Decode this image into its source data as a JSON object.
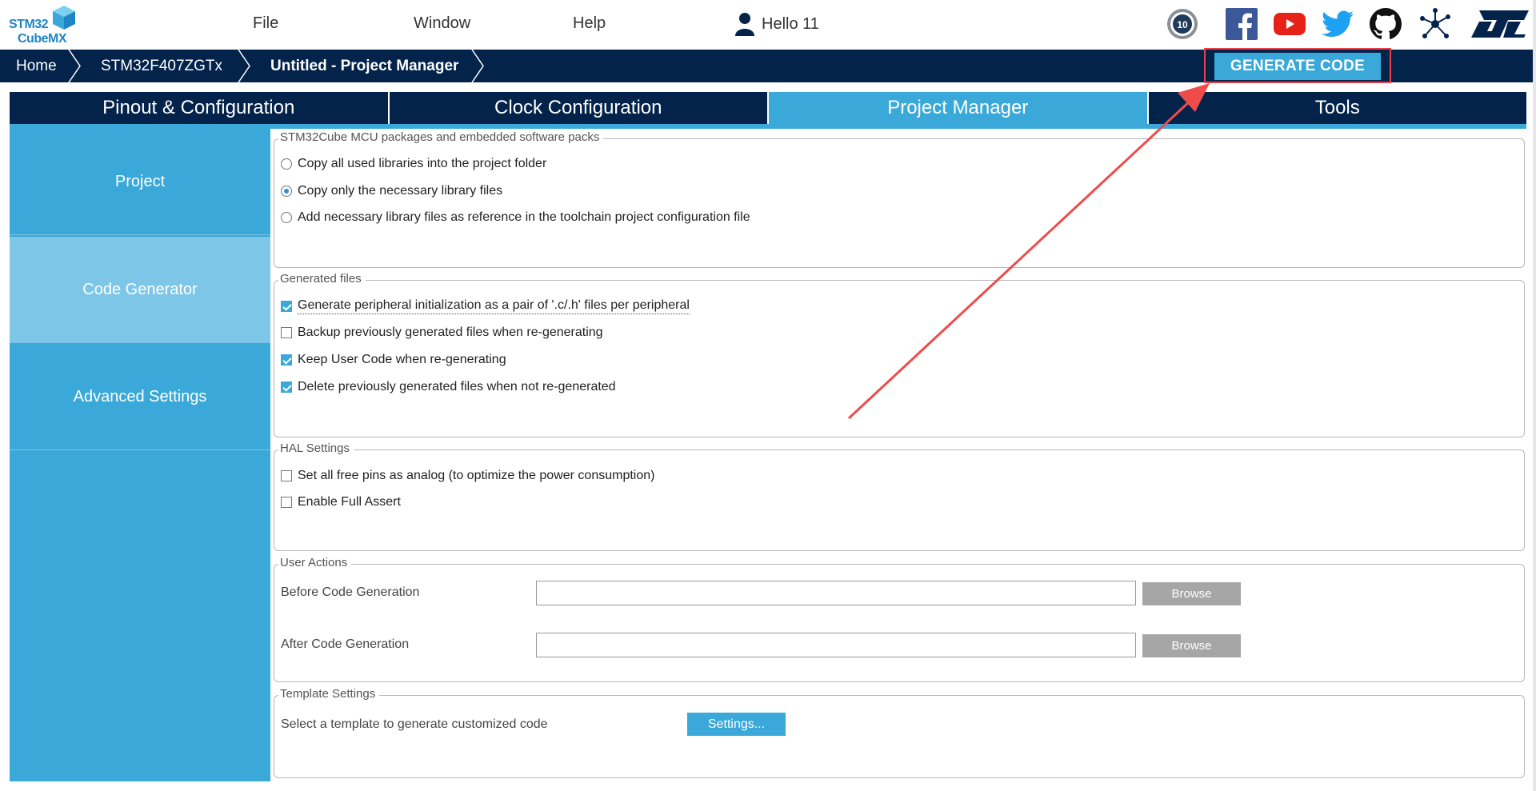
{
  "app": {
    "logo_line1": "STM32",
    "logo_line2": "CubeMX",
    "menu": [
      "File",
      "Window",
      "Help"
    ],
    "user_greeting": "Hello 11",
    "social_icons": [
      "anniversary-badge-icon",
      "facebook-icon",
      "youtube-icon",
      "twitter-icon",
      "github-icon",
      "network-icon",
      "st-logo-icon"
    ]
  },
  "breadcrumb": {
    "items": [
      "Home",
      "STM32F407ZGTx",
      "Untitled - Project Manager"
    ],
    "generate_label": "GENERATE CODE"
  },
  "tabs": [
    {
      "label": "Pinout & Configuration",
      "active": false
    },
    {
      "label": "Clock Configuration",
      "active": false
    },
    {
      "label": "Project Manager",
      "active": true
    },
    {
      "label": "Tools",
      "active": false
    }
  ],
  "sidenav": [
    {
      "label": "Project",
      "active": false
    },
    {
      "label": "Code Generator",
      "active": true
    },
    {
      "label": "Advanced Settings",
      "active": false
    }
  ],
  "packs": {
    "legend": "STM32Cube MCU packages and embedded software packs",
    "options": [
      {
        "label": "Copy all used libraries into the project folder",
        "selected": false
      },
      {
        "label": "Copy only the necessary library files",
        "selected": true
      },
      {
        "label": "Add necessary library files as reference in the toolchain project configuration file",
        "selected": false
      }
    ]
  },
  "generated_files": {
    "legend": "Generated files",
    "options": [
      {
        "label": "Generate peripheral initialization as a pair of '.c/.h' files per peripheral",
        "checked": true
      },
      {
        "label": "Backup previously generated files when re-generating",
        "checked": false
      },
      {
        "label": "Keep User Code when re-generating",
        "checked": true
      },
      {
        "label": "Delete previously generated files when not re-generated",
        "checked": true
      }
    ]
  },
  "hal": {
    "legend": "HAL Settings",
    "options": [
      {
        "label": "Set all free pins as analog (to optimize the power consumption)",
        "checked": false
      },
      {
        "label": "Enable Full Assert",
        "checked": false
      }
    ]
  },
  "user_actions": {
    "legend": "User Actions",
    "before_label": "Before Code Generation",
    "before_value": "",
    "after_label": "After Code Generation",
    "after_value": "",
    "browse_label": "Browse"
  },
  "template": {
    "legend": "Template Settings",
    "label": "Select a template to generate customized code",
    "button_label": "Settings..."
  },
  "colors": {
    "navy": "#03234b",
    "accent": "#3aa8d8",
    "active_side": "#7dc6e8",
    "annotation_red": "#e8424b"
  }
}
